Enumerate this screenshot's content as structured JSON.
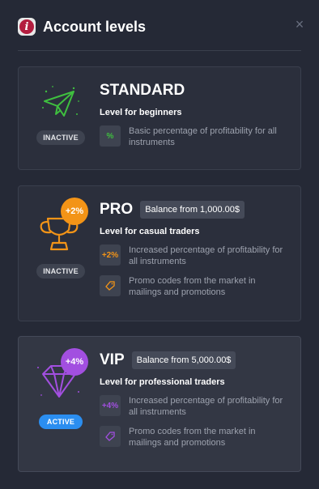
{
  "header": {
    "info_glyph": "i",
    "title": "Account levels",
    "close_glyph": "×"
  },
  "levels": [
    {
      "name": "STANDARD",
      "status": "INACTIVE",
      "description": "Level for beginners",
      "features": [
        {
          "icon": "%",
          "text": "Basic percentage of profitability for all instruments"
        }
      ],
      "icon": "paper-plane-icon",
      "accent": "#3fbf3f"
    },
    {
      "name": "PRO",
      "balance": "Balance from 1,000.00$",
      "status": "INACTIVE",
      "description": "Level for casual traders",
      "bonus": "+2%",
      "features": [
        {
          "icon": "+2%",
          "text": "Increased percentage of profitability for all instruments"
        },
        {
          "icon": "tag-icon",
          "text": "Promo codes from the market in mailings and promotions"
        }
      ],
      "icon": "trophy-icon",
      "accent": "#f39417"
    },
    {
      "name": "VIP",
      "balance": "Balance from 5,000.00$",
      "status": "ACTIVE",
      "description": "Level for professional traders",
      "bonus": "+4%",
      "features": [
        {
          "icon": "+4%",
          "text": "Increased percentage of profitability for all instruments"
        },
        {
          "icon": "tag-icon",
          "text": "Promo codes from the market in mailings and promotions"
        }
      ],
      "icon": "diamond-icon",
      "accent": "#a24fe0"
    }
  ]
}
